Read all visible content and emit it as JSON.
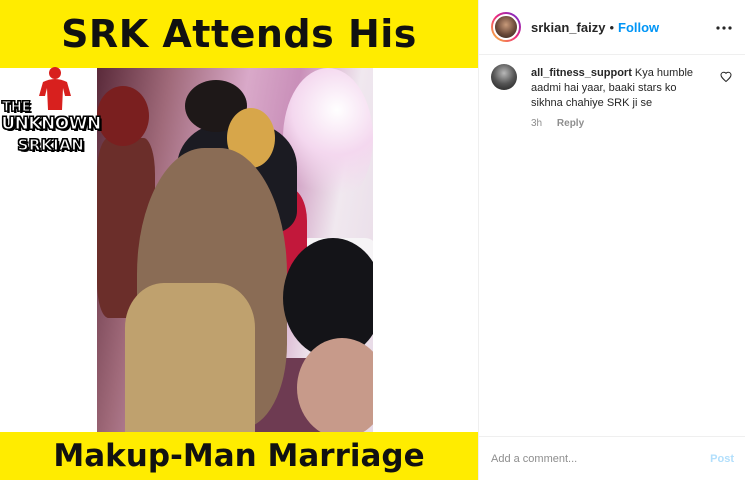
{
  "media": {
    "top_caption": "SRK Attends His",
    "bottom_caption": "Makup-Man Marriage",
    "banner_color": "#ffec00",
    "logo": {
      "line1": "THE",
      "line2": "UNKNOWN",
      "line3": "SRKIAN",
      "figure_color": "#d8201e"
    }
  },
  "post_header": {
    "username": "srkian_faizy",
    "separator": "•",
    "follow_label": "Follow",
    "more_icon": "more-horizontal-icon"
  },
  "comments": [
    {
      "username": "all_fitness_support",
      "text": "Kya humble aadmi hai yaar, baaki stars ko sikhna chahiye SRK ji se",
      "time": "3h",
      "reply_label": "Reply",
      "like_icon": "heart-icon"
    }
  ],
  "add_comment": {
    "placeholder": "Add a comment...",
    "post_label": "Post"
  },
  "colors": {
    "accent_link": "#0095f6",
    "post_disabled": "#b2dffc",
    "muted_text": "#8e8e8e"
  }
}
